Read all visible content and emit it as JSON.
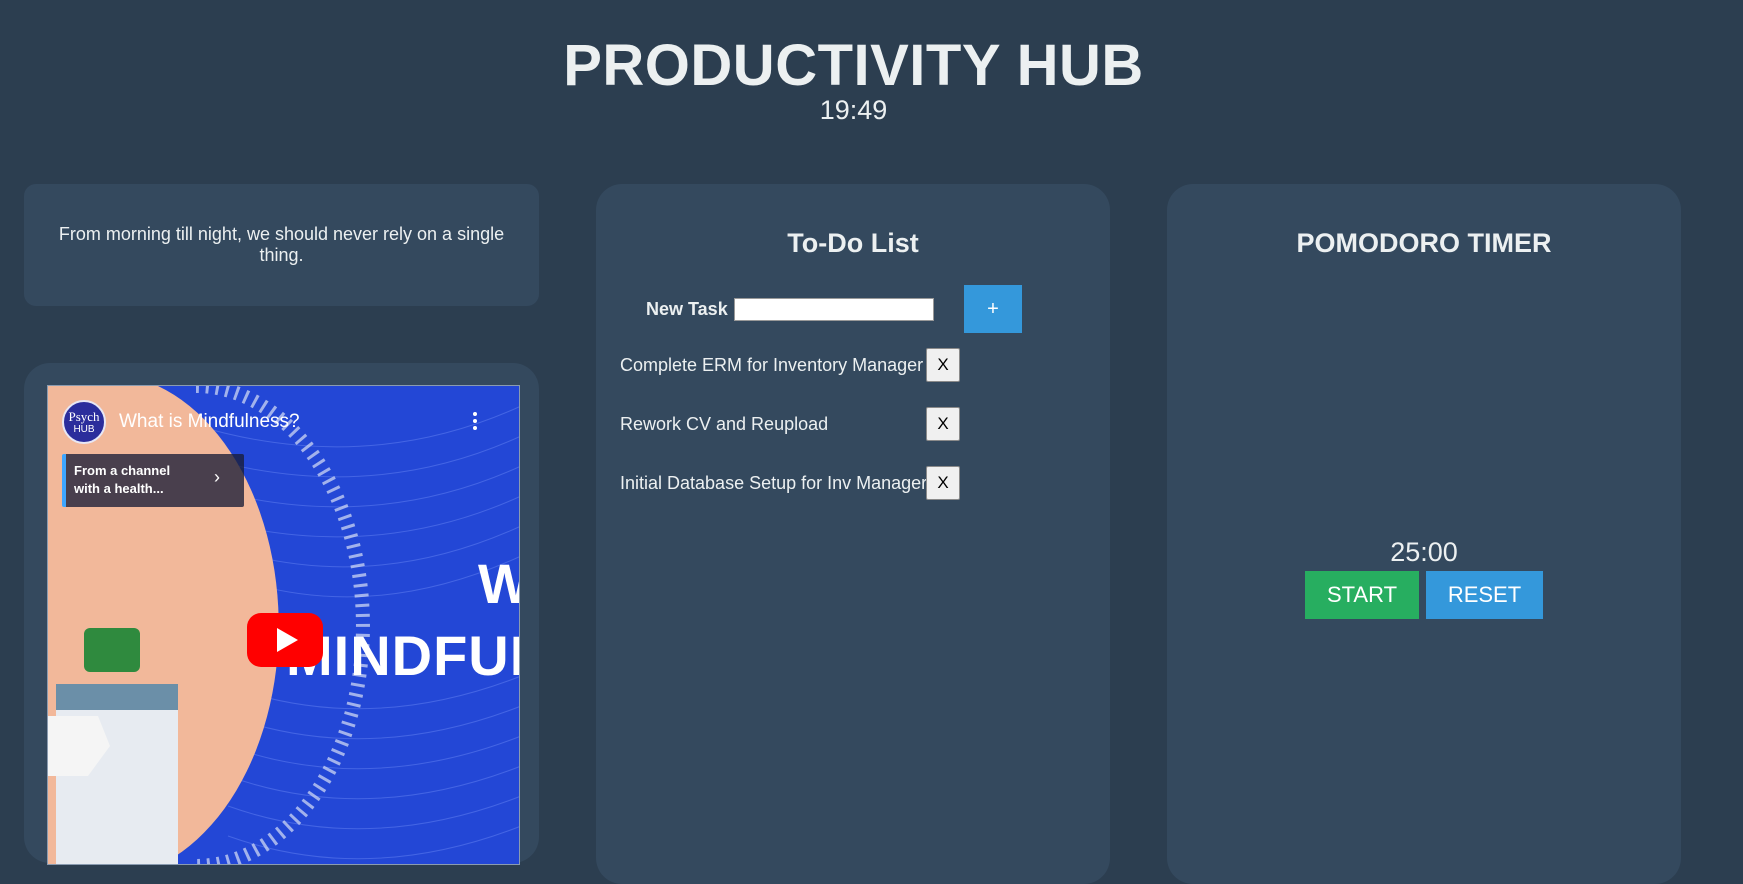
{
  "header": {
    "title": "PRODUCTIVITY HUB",
    "clock": "19:49"
  },
  "quote": {
    "text": "From morning till night, we should never rely on a single thing."
  },
  "video": {
    "channel_logo_text": "Psych",
    "channel_logo_sub": "HUB",
    "title": "What is Mindfulness?",
    "chip_line1": "From a channel",
    "chip_line2": "with a health...",
    "chip_arrow": "›",
    "overlay_w": "W",
    "overlay_mindfulness": "MINDFUL"
  },
  "todo": {
    "title": "To-Do List",
    "new_task_label": "New Task",
    "new_task_value": "",
    "add_label": "+",
    "delete_label": "X",
    "tasks": [
      {
        "label": "Complete ERM for Inventory Manager"
      },
      {
        "label": "Rework CV and Reupload"
      },
      {
        "label": "Initial Database Setup for Inv Manager"
      }
    ]
  },
  "pomodoro": {
    "title": "POMODORO TIMER",
    "time": "25:00",
    "start_label": "START",
    "reset_label": "RESET"
  },
  "colors": {
    "background": "#2c3e50",
    "card": "#34495e",
    "primary": "#3498db",
    "success": "#27ae60"
  }
}
